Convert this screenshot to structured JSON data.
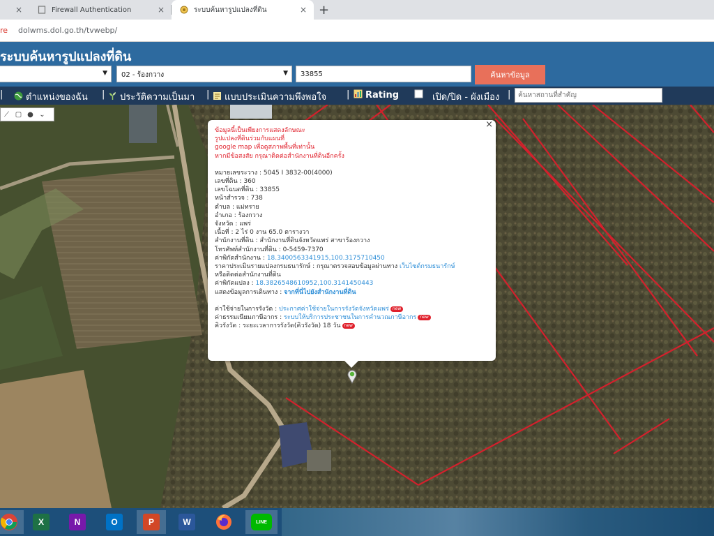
{
  "browser": {
    "tabs": [
      {
        "title": "",
        "active": false
      },
      {
        "title": "Firewall Authentication",
        "active": false
      },
      {
        "title": "ระบบค้นหารูปแปลงที่ดิน",
        "active": true
      }
    ],
    "new_tab_glyph": "+",
    "close_glyph": "×",
    "address": {
      "security_text": "re",
      "url": "dolwms.dol.go.th/tvwebp/"
    }
  },
  "site": {
    "title": "ระบบค้นหารูปแปลงที่ดิน",
    "province_value": "",
    "district_value": "02 - ร้องกวาง",
    "parcel_value": "33855",
    "search_button": "ค้นหาข้อมูล"
  },
  "menu": {
    "items": [
      {
        "label": "ตำแหน่งของฉัน",
        "icon": "globe-icon"
      },
      {
        "label": "ประวัติความเป็นมา",
        "icon": "sprout-icon"
      },
      {
        "label": "แบบประเมินความพึงพอใจ",
        "icon": "form-icon"
      },
      {
        "label": "Rating",
        "icon": "chart-icon"
      },
      {
        "label": "เปิด/ปิด - ผังเมือง",
        "icon": "checkbox-icon"
      }
    ],
    "separator": "|",
    "place_search_placeholder": "ค้นหาสถานที่สำคัญ"
  },
  "popup": {
    "disclaimer": [
      "ข้อมูลนี้เป็นเพียงการแสดงลักษณะ",
      "รูปแปลงที่ดินร่วมกับแผนที่",
      "google map",
      "เพื่อดูสภาพพื้นที่เท่านั้น",
      "หากมีข้อสงสัย กรุณาติดต่อสำนักงานที่ดินอีกครั้ง"
    ],
    "fields": {
      "map_sheet": {
        "label": "หมายเลขระวาง",
        "value": "5045 I 3832-00(4000)"
      },
      "land_no": {
        "label": "เลขที่ดิน",
        "value": "360"
      },
      "deed_no": {
        "label": "เลขโฉนดที่ดิน",
        "value": "33855"
      },
      "survey_page": {
        "label": "หน้าสำรวจ",
        "value": "738"
      },
      "tambon": {
        "label": "ตำบล",
        "value": "แม่ทราย"
      },
      "amphoe": {
        "label": "อำเภอ",
        "value": "ร้องกวาง"
      },
      "province": {
        "label": "จังหวัด",
        "value": "แพร่"
      },
      "area": {
        "label": "เนื้อที่",
        "value": "2 ไร่ 0 งาน 65.0 ตารางวา"
      },
      "office": {
        "label": "สำนักงานที่ดิน",
        "value": "สำนักงานที่ดินจังหวัดแพร่ สาขาร้องกวาง"
      },
      "office_phone": {
        "label": "โทรศัพท์สำนักงานที่ดิน",
        "value": "0-5459-7370"
      },
      "office_coord": {
        "label": "ค่าพิกัดสำนักงาน",
        "value": "18.3400563341915,100.3175710450"
      },
      "appraisal": {
        "label": "ราคาประเมินรายแปลงกรมธนารักษ์",
        "value": "กรุณาตรวจสอบข้อมูลผ่านทาง",
        "link": "เว็บไซต์กรมธนารักษ์",
        "suffix": "หรือติดต่อสำนักงานที่ดิน"
      },
      "parcel_coord": {
        "label": "ค่าพิกัดแปลง",
        "value": "18.3826548610952,100.3141450443"
      },
      "route": {
        "label": "แสดงข้อมูลการเดินทาง",
        "link": "จากที่นี่ไปยังสำนักงานที่ดิน"
      },
      "fee": {
        "label": "ค่าใช้จ่ายในการรังวัด",
        "link": "ประกาศค่าใช้จ่ายในการรังวัดจังหวัดแพร่"
      },
      "tax": {
        "label": "ค่าธรรมเนียมภาษีอากร",
        "link": "ระบบให้บริการประชาชนในการคำนวณภาษีอากร"
      },
      "queue": {
        "label": "คิวรังวัด",
        "value": "ระยะเวลาการรังวัด(คิวรังวัด) 18 วัน"
      }
    },
    "new_badge": "new"
  },
  "taskbar": {
    "apps": [
      {
        "name": "chrome-icon",
        "glyph": "",
        "color": "#db4437",
        "active": true
      },
      {
        "name": "excel-icon",
        "glyph": "X",
        "color": "#1e7145",
        "active": false
      },
      {
        "name": "onenote-icon",
        "glyph": "N",
        "color": "#7719aa",
        "active": false
      },
      {
        "name": "outlook-icon",
        "glyph": "O",
        "color": "#0072c6",
        "active": false
      },
      {
        "name": "powerpoint-icon",
        "glyph": "P",
        "color": "#d24726",
        "active": true
      },
      {
        "name": "word-icon",
        "glyph": "W",
        "color": "#2b579a",
        "active": false
      },
      {
        "name": "firefox-icon",
        "glyph": "",
        "color": "#ff7139",
        "active": false
      },
      {
        "name": "line-icon",
        "glyph": "LINE",
        "color": "#00b900",
        "active": true
      }
    ]
  }
}
